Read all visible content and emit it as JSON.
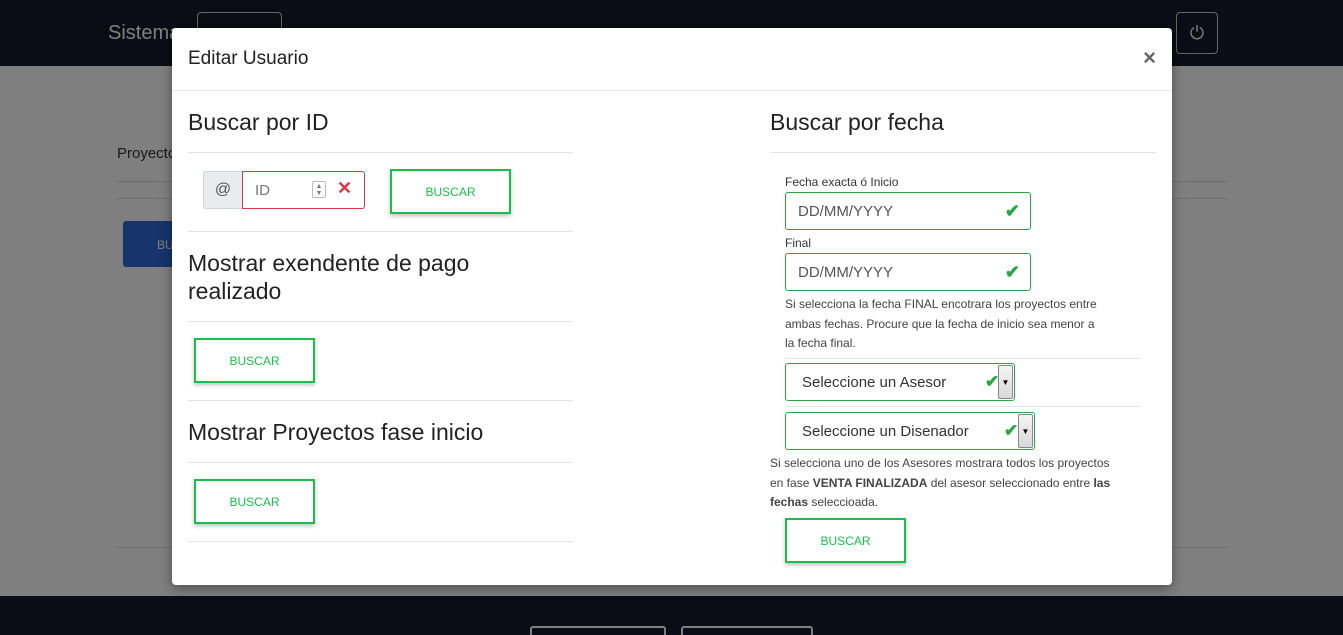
{
  "background": {
    "brand": "Sistema",
    "proyectos_label": "Proyecto",
    "blue_button_label": "BU",
    "power_icon": "power-icon"
  },
  "modal": {
    "title": "Editar Usuario",
    "close_label": "×",
    "id_search": {
      "title": "Buscar por ID",
      "addon": "@",
      "placeholder": "ID",
      "button": "BUSCAR"
    },
    "pago": {
      "title_line1": "Mostrar exendente de pago",
      "title_line2": "realizado",
      "button": "BUSCAR"
    },
    "fase_inicio": {
      "title": "Mostrar Proyectos fase inicio",
      "button": "BUSCAR"
    },
    "fecha": {
      "title": "Buscar por fecha",
      "start_label": "Fecha exacta ó Inicio",
      "start_placeholder": "DD/MM/YYYY",
      "end_label": "Final",
      "end_placeholder": "DD/MM/YYYY",
      "help_line1": "Si selecciona la fecha FINAL encotrara los proyectos entre",
      "help_line2": "ambas fechas. Procure que la fecha de inicio sea menor a",
      "help_line3": "la fecha final.",
      "asesor_select": "Seleccione un Asesor",
      "disenador_select": "Seleccione un Disenador",
      "note_line1": "Si selecciona uno de los Asesores mostrara todos los proyectos",
      "note_line2_a": "en fase ",
      "note_line2_b": "VENTA FINALIZADA",
      "note_line2_c": " del asesor seleccionado entre ",
      "note_line2_d": "las",
      "note_line3_a": "fechas",
      "note_line3_b": " seleccioada.",
      "button": "BUSCAR"
    }
  },
  "colors": {
    "success": "#18c04b",
    "danger": "#dc3545",
    "navbar": "#141a2b"
  }
}
